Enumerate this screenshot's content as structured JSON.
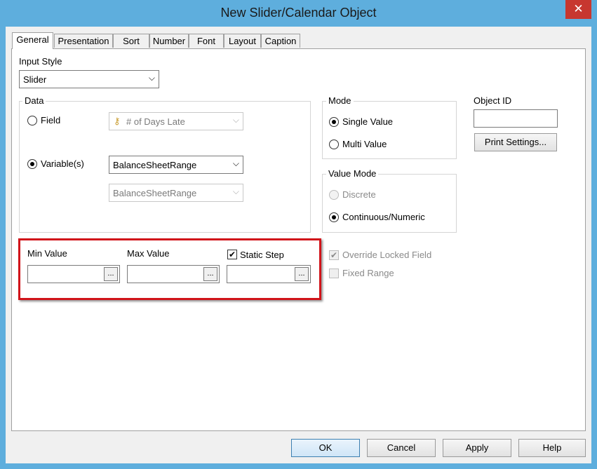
{
  "window": {
    "title": "New Slider/Calendar Object",
    "close_glyph": "✕"
  },
  "tabs": [
    {
      "label": "General",
      "active": true
    },
    {
      "label": "Presentation"
    },
    {
      "label": "Sort"
    },
    {
      "label": "Number"
    },
    {
      "label": "Font"
    },
    {
      "label": "Layout"
    },
    {
      "label": "Caption"
    }
  ],
  "input_style": {
    "label": "Input Style",
    "value": "Slider"
  },
  "data_group": {
    "title": "Data",
    "field_label": "Field",
    "field_value": "# of Days Late",
    "field_icon": "key-icon",
    "variables_label": "Variable(s)",
    "variable_value": "BalanceSheetRange",
    "variable_value_2": "BalanceSheetRange"
  },
  "mode_group": {
    "title": "Mode",
    "single": "Single Value",
    "multi": "Multi Value"
  },
  "value_mode_group": {
    "title": "Value Mode",
    "discrete": "Discrete",
    "continuous": "Continuous/Numeric"
  },
  "object_id": {
    "label": "Object ID",
    "value": ""
  },
  "print_settings_label": "Print Settings...",
  "range": {
    "min_label": "Min Value",
    "max_label": "Max Value",
    "static_step_label": "Static Step",
    "static_step_checked": true,
    "ellipsis": "..."
  },
  "override_locked_label": "Override Locked Field",
  "fixed_range_label": "Fixed Range",
  "buttons": {
    "ok": "OK",
    "cancel": "Cancel",
    "apply": "Apply",
    "help": "Help"
  },
  "colors": {
    "frame": "#5eaedd",
    "close": "#c7372f",
    "highlight": "#d1141a"
  }
}
